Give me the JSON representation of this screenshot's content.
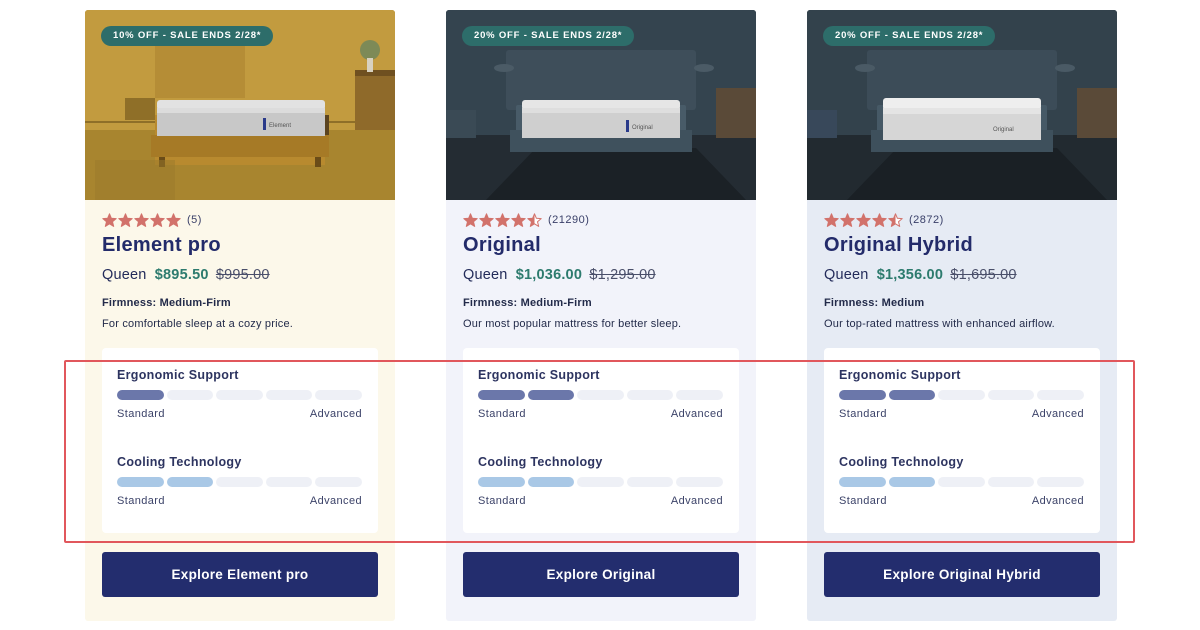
{
  "cards": [
    {
      "badge": "10% OFF - SALE ENDS 2/28*",
      "rating": 5,
      "rating_count": "(5)",
      "title": "Element pro",
      "size": "Queen",
      "sale_price": "$895.50",
      "original_price": "$995.00",
      "firmness": "Firmness: Medium-Firm",
      "description": "For comfortable sleep at a cozy price.",
      "ergonomic_label": "Ergonomic Support",
      "ergonomic_level": 1,
      "cooling_label": "Cooling Technology",
      "cooling_level": 2,
      "scale_min": "Standard",
      "scale_max": "Advanced",
      "cta": "Explore Element pro",
      "brand_label": "Element"
    },
    {
      "badge": "20% OFF - SALE ENDS 2/28*",
      "rating": 4.5,
      "rating_count": "(21290)",
      "title": "Original",
      "size": "Queen",
      "sale_price": "$1,036.00",
      "original_price": "$1,295.00",
      "firmness": "Firmness: Medium-Firm",
      "description": "Our most popular mattress for better sleep.",
      "ergonomic_label": "Ergonomic Support",
      "ergonomic_level": 2,
      "cooling_label": "Cooling Technology",
      "cooling_level": 2,
      "scale_min": "Standard",
      "scale_max": "Advanced",
      "cta": "Explore Original",
      "brand_label": "Original"
    },
    {
      "badge": "20% OFF - SALE ENDS 2/28*",
      "rating": 4.5,
      "rating_count": "(2872)",
      "title": "Original Hybrid",
      "size": "Queen",
      "sale_price": "$1,356.00",
      "original_price": "$1,695.00",
      "firmness": "Firmness: Medium",
      "description": "Our top-rated mattress with enhanced airflow.",
      "ergonomic_label": "Ergonomic Support",
      "ergonomic_level": 2,
      "cooling_label": "Cooling Technology",
      "cooling_level": 2,
      "scale_min": "Standard",
      "scale_max": "Advanced",
      "cta": "Explore Original Hybrid",
      "brand_label": "Original"
    }
  ],
  "meter_segments": 5,
  "colors": {
    "accent_navy": "#232d6e",
    "sale_green": "#2d7b6e",
    "badge_teal": "#2d6d6a",
    "star": "#d2726b",
    "ergonomic_fill": "#6b77aa",
    "cooling_fill": "#a9c8e6",
    "highlight": "#e1575c"
  }
}
